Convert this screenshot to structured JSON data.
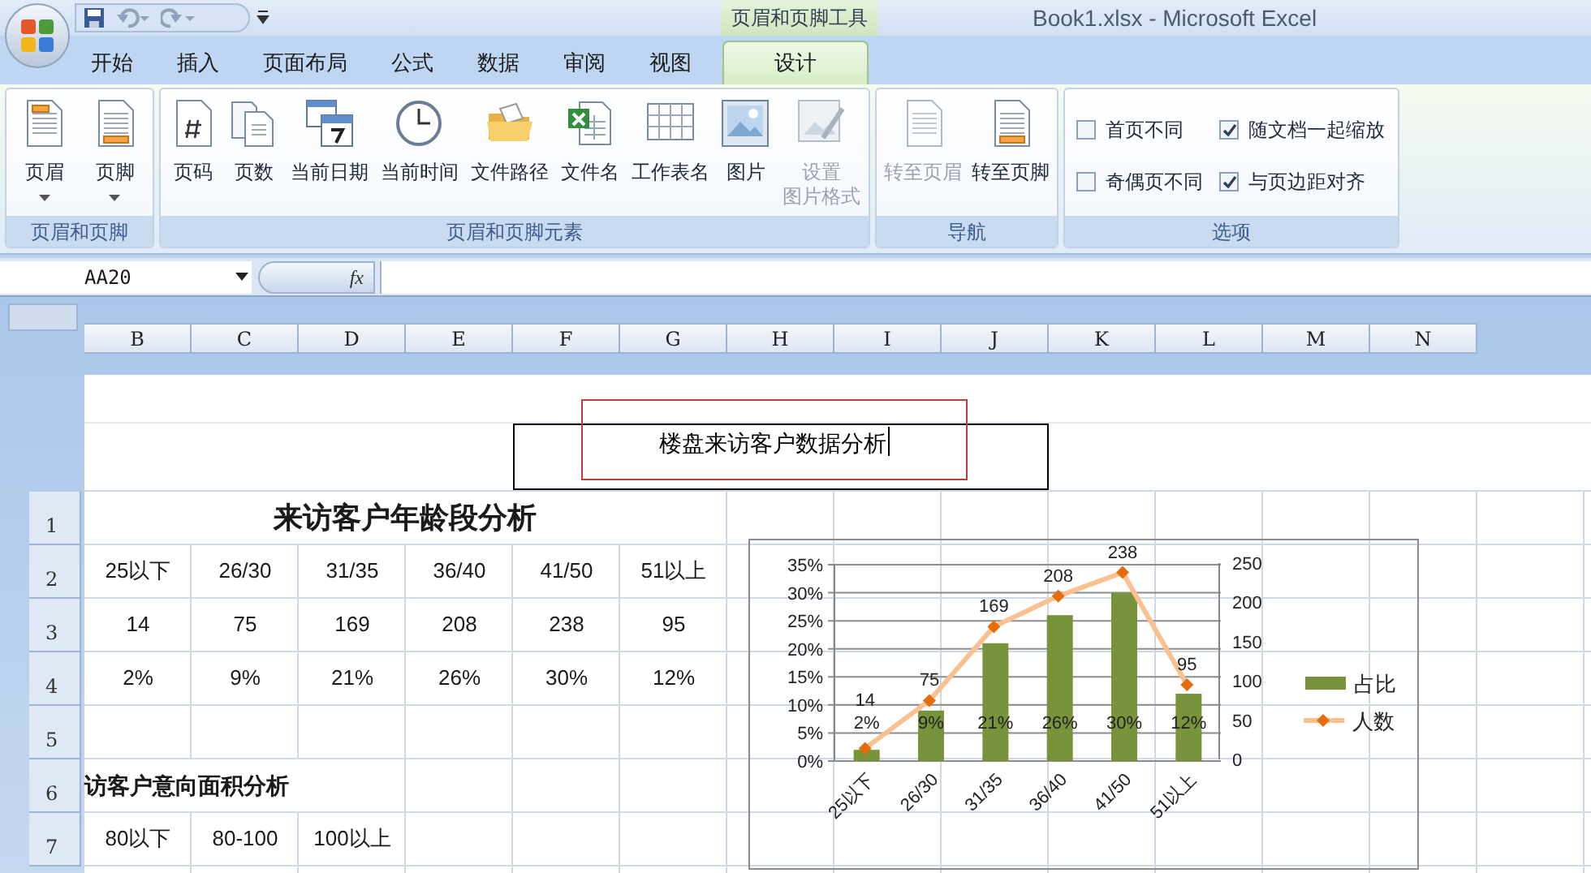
{
  "window": {
    "title": "Book1.xlsx - Microsoft Excel"
  },
  "contextual_tab_group": {
    "label": "页眉和页脚工具"
  },
  "tabs": [
    {
      "label": "开始",
      "selected": false
    },
    {
      "label": "插入",
      "selected": false
    },
    {
      "label": "页面布局",
      "selected": false
    },
    {
      "label": "公式",
      "selected": false
    },
    {
      "label": "数据",
      "selected": false
    },
    {
      "label": "审阅",
      "selected": false
    },
    {
      "label": "视图",
      "selected": false
    },
    {
      "label": "设计",
      "selected": true
    }
  ],
  "ribbon_groups": [
    {
      "title": "页眉和页脚",
      "buttons": [
        {
          "label": "页眉",
          "dropdown": true,
          "disabled": false
        },
        {
          "label": "页脚",
          "dropdown": true,
          "disabled": false
        }
      ]
    },
    {
      "title": "页眉和页脚元素",
      "buttons": [
        {
          "label": "页码",
          "disabled": false
        },
        {
          "label": "页数",
          "disabled": false
        },
        {
          "label": "当前日期",
          "disabled": false
        },
        {
          "label": "当前时间",
          "disabled": false
        },
        {
          "label": "文件路径",
          "disabled": false
        },
        {
          "label": "文件名",
          "disabled": false
        },
        {
          "label": "工作表名",
          "disabled": false
        },
        {
          "label": "图片",
          "disabled": false
        },
        {
          "label": "设置",
          "label_line_2": "图片格式",
          "disabled": true
        }
      ]
    },
    {
      "title": "导航",
      "buttons": [
        {
          "label": "转至页眉",
          "disabled": true
        },
        {
          "label": "转至页脚",
          "disabled": false
        }
      ]
    },
    {
      "title": "选项",
      "checkboxes": [
        {
          "label": "首页不同",
          "checked": false
        },
        {
          "label": "随文档一起缩放",
          "checked": true
        },
        {
          "label": "奇偶页不同",
          "checked": false
        },
        {
          "label": "与页边距对齐",
          "checked": true
        }
      ]
    }
  ],
  "name_box": {
    "value": "AA20"
  },
  "formula_bar": {
    "function_label": "fx"
  },
  "columns": [
    "B",
    "C",
    "D",
    "E",
    "F",
    "G",
    "H",
    "I",
    "J",
    "K",
    "L",
    "M",
    "N"
  ],
  "page_header": {
    "text": "楼盘来访客户数据分析"
  },
  "rows": [
    {
      "number": "1",
      "kind": "title",
      "title": "来访客户年龄段分析"
    },
    {
      "number": "2",
      "kind": "data",
      "cells": [
        "25以下",
        "26/30",
        "31/35",
        "36/40",
        "41/50",
        "51以上"
      ]
    },
    {
      "number": "3",
      "kind": "data",
      "cells": [
        "14",
        "75",
        "169",
        "208",
        "238",
        "95"
      ]
    },
    {
      "number": "4",
      "kind": "data",
      "cells": [
        "2%",
        "9%",
        "21%",
        "26%",
        "30%",
        "12%"
      ]
    },
    {
      "number": "5",
      "kind": "data"
    },
    {
      "number": "6",
      "kind": "section",
      "title": "访客户意向面积分析"
    },
    {
      "number": "7",
      "kind": "data",
      "cells": [
        "80以下",
        "80-100",
        "100以上"
      ]
    }
  ],
  "chart": {
    "bar_layer": {
      "chart_data": {
        "type": "bar",
        "categories": [
          "25以下",
          "26/30",
          "31/35",
          "36/40",
          "41/50",
          "51以上"
        ],
        "series": [
          {
            "name": "占比",
            "color": "#77933c",
            "values": [
              2,
              9,
              21,
              26,
              30,
              12
            ],
            "value_labels": [
              "2%",
              "9%",
              "21%",
              "26%",
              "30%",
              "12%"
            ]
          }
        ],
        "ylim": [
          0,
          35
        ],
        "yticks": [
          {
            "value": 0,
            "label": "0%"
          },
          {
            "value": 5,
            "label": "5%"
          },
          {
            "value": 10,
            "label": "10%"
          },
          {
            "value": 15,
            "label": "15%"
          },
          {
            "value": 20,
            "label": "20%"
          },
          {
            "value": 25,
            "label": "25%"
          },
          {
            "value": 30,
            "label": "30%"
          },
          {
            "value": 35,
            "label": "35%"
          }
        ],
        "grid": true,
        "data_labels": true
      }
    },
    "line_layer": {
      "chart_data": {
        "type": "line",
        "series": [
          {
            "name": "人数",
            "color": "#e46c0a",
            "marker": "diamond",
            "values": [
              14,
              75,
              169,
              208,
              238,
              95
            ],
            "value_labels": [
              "14",
              "75",
              "169",
              "208",
              "238",
              "95"
            ]
          }
        ],
        "ylim": [
          0,
          250
        ],
        "yticks": [
          0,
          50,
          100,
          150,
          200,
          250
        ],
        "data_labels": true
      }
    }
  }
}
